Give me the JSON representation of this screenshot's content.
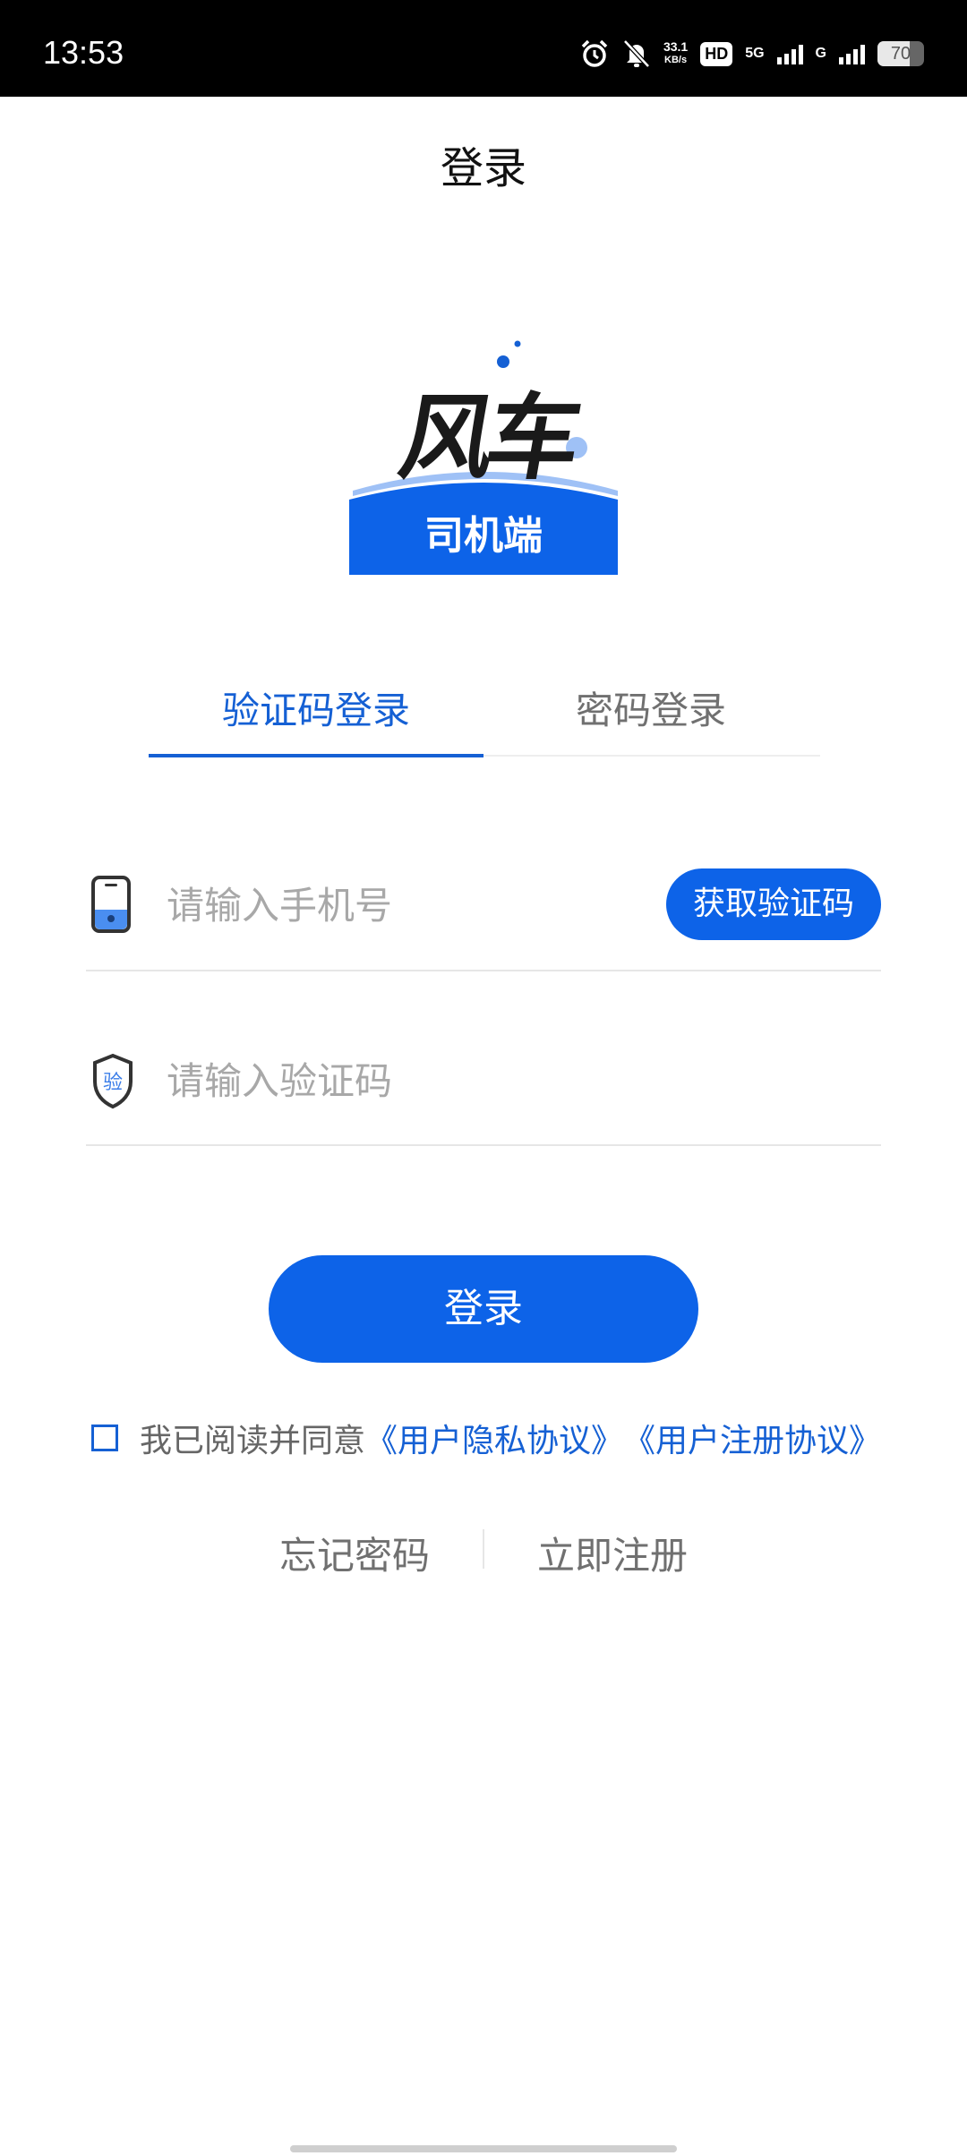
{
  "status_bar": {
    "time": "13:53",
    "net_speed_value": "33.1",
    "net_speed_unit": "KB/s",
    "hd": "HD",
    "sim1_network": "5G",
    "sim2_network": "G",
    "battery_level": "70",
    "battery_fraction": 0.7,
    "icons": [
      "alarm-icon",
      "bell-off-icon",
      "hd-icon",
      "signal-icon",
      "signal-icon",
      "battery-icon"
    ]
  },
  "header": {
    "title": "登录"
  },
  "logo": {
    "brand": "风车",
    "subtitle": "司机端"
  },
  "tabs": [
    {
      "label": "验证码登录",
      "active": true
    },
    {
      "label": "密码登录",
      "active": false
    }
  ],
  "form": {
    "phone_placeholder": "请输入手机号",
    "phone_value": "",
    "code_placeholder": "请输入验证码",
    "code_value": "",
    "get_code_label": "获取验证码",
    "shield_icon_text": "验",
    "login_label": "登录"
  },
  "agreement": {
    "checked": false,
    "text": "我已阅读并同意",
    "privacy_link": "《用户隐私协议》",
    "register_link": "《用户注册协议》"
  },
  "footer_links": {
    "forgot": "忘记密码",
    "register": "立即注册"
  },
  "colors": {
    "accent": "#0d63e8",
    "accent_text": "#1560d4"
  }
}
